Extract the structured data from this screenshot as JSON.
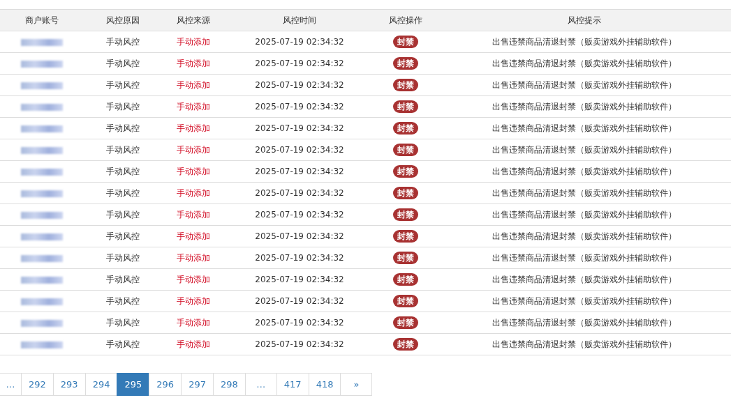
{
  "table": {
    "columns": [
      "商户账号",
      "风控原因",
      "风控来源",
      "风控时间",
      "风控操作",
      "风控提示"
    ],
    "rows": [
      {
        "reason": "手动风控",
        "source": "手动添加",
        "time": "2025-07-19 02:34:32",
        "action": "封禁",
        "tip": "出售违禁商品清退封禁（贩卖游戏外挂辅助软件）"
      },
      {
        "reason": "手动风控",
        "source": "手动添加",
        "time": "2025-07-19 02:34:32",
        "action": "封禁",
        "tip": "出售违禁商品清退封禁（贩卖游戏外挂辅助软件）"
      },
      {
        "reason": "手动风控",
        "source": "手动添加",
        "time": "2025-07-19 02:34:32",
        "action": "封禁",
        "tip": "出售违禁商品清退封禁（贩卖游戏外挂辅助软件）"
      },
      {
        "reason": "手动风控",
        "source": "手动添加",
        "time": "2025-07-19 02:34:32",
        "action": "封禁",
        "tip": "出售违禁商品清退封禁（贩卖游戏外挂辅助软件）"
      },
      {
        "reason": "手动风控",
        "source": "手动添加",
        "time": "2025-07-19 02:34:32",
        "action": "封禁",
        "tip": "出售违禁商品清退封禁（贩卖游戏外挂辅助软件）"
      },
      {
        "reason": "手动风控",
        "source": "手动添加",
        "time": "2025-07-19 02:34:32",
        "action": "封禁",
        "tip": "出售违禁商品清退封禁（贩卖游戏外挂辅助软件）"
      },
      {
        "reason": "手动风控",
        "source": "手动添加",
        "time": "2025-07-19 02:34:32",
        "action": "封禁",
        "tip": "出售违禁商品清退封禁（贩卖游戏外挂辅助软件）"
      },
      {
        "reason": "手动风控",
        "source": "手动添加",
        "time": "2025-07-19 02:34:32",
        "action": "封禁",
        "tip": "出售违禁商品清退封禁（贩卖游戏外挂辅助软件）"
      },
      {
        "reason": "手动风控",
        "source": "手动添加",
        "time": "2025-07-19 02:34:32",
        "action": "封禁",
        "tip": "出售违禁商品清退封禁（贩卖游戏外挂辅助软件）"
      },
      {
        "reason": "手动风控",
        "source": "手动添加",
        "time": "2025-07-19 02:34:32",
        "action": "封禁",
        "tip": "出售违禁商品清退封禁（贩卖游戏外挂辅助软件）"
      },
      {
        "reason": "手动风控",
        "source": "手动添加",
        "time": "2025-07-19 02:34:32",
        "action": "封禁",
        "tip": "出售违禁商品清退封禁（贩卖游戏外挂辅助软件）"
      },
      {
        "reason": "手动风控",
        "source": "手动添加",
        "time": "2025-07-19 02:34:32",
        "action": "封禁",
        "tip": "出售违禁商品清退封禁（贩卖游戏外挂辅助软件）"
      },
      {
        "reason": "手动风控",
        "source": "手动添加",
        "time": "2025-07-19 02:34:32",
        "action": "封禁",
        "tip": "出售违禁商品清退封禁（贩卖游戏外挂辅助软件）"
      },
      {
        "reason": "手动风控",
        "source": "手动添加",
        "time": "2025-07-19 02:34:32",
        "action": "封禁",
        "tip": "出售违禁商品清退封禁（贩卖游戏外挂辅助软件）"
      },
      {
        "reason": "手动风控",
        "source": "手动添加",
        "time": "2025-07-19 02:34:32",
        "action": "封禁",
        "tip": "出售违禁商品清退封禁（贩卖游戏外挂辅助软件）"
      }
    ]
  },
  "pagination": [
    {
      "label": "…",
      "selected": false
    },
    {
      "label": "292",
      "selected": false
    },
    {
      "label": "293",
      "selected": false
    },
    {
      "label": "294",
      "selected": false
    },
    {
      "label": "295",
      "selected": true
    },
    {
      "label": "296",
      "selected": false
    },
    {
      "label": "297",
      "selected": false
    },
    {
      "label": "298",
      "selected": false
    },
    {
      "label": "…",
      "selected": false
    },
    {
      "label": "417",
      "selected": false
    },
    {
      "label": "418",
      "selected": false
    },
    {
      "label": "»",
      "selected": false
    }
  ]
}
